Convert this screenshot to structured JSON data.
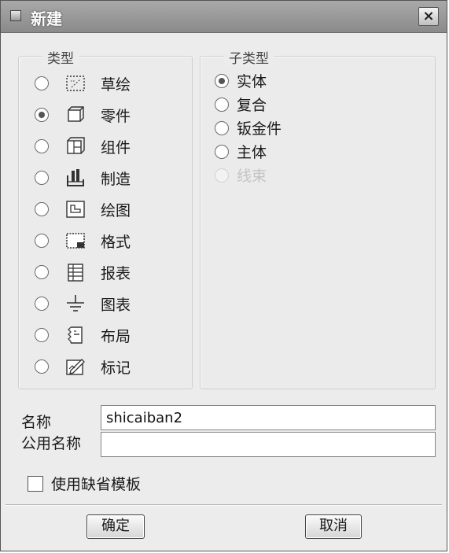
{
  "window": {
    "title": "新建",
    "close_label": "×"
  },
  "type_group": {
    "title": "类型",
    "items": [
      {
        "label": "草绘",
        "icon": "sketch-icon",
        "checked": false
      },
      {
        "label": "零件",
        "icon": "part-icon",
        "checked": true
      },
      {
        "label": "组件",
        "icon": "assembly-icon",
        "checked": false
      },
      {
        "label": "制造",
        "icon": "manufacturing-icon",
        "checked": false
      },
      {
        "label": "绘图",
        "icon": "drawing-icon",
        "checked": false
      },
      {
        "label": "格式",
        "icon": "format-icon",
        "checked": false
      },
      {
        "label": "报表",
        "icon": "report-icon",
        "checked": false
      },
      {
        "label": "图表",
        "icon": "diagram-icon",
        "checked": false
      },
      {
        "label": "布局",
        "icon": "layout-icon",
        "checked": false
      },
      {
        "label": "标记",
        "icon": "markup-icon",
        "checked": false
      }
    ]
  },
  "subtype_group": {
    "title": "子类型",
    "items": [
      {
        "label": "实体",
        "checked": true,
        "disabled": false
      },
      {
        "label": "复合",
        "checked": false,
        "disabled": false
      },
      {
        "label": "钣金件",
        "checked": false,
        "disabled": false
      },
      {
        "label": "主体",
        "checked": false,
        "disabled": false
      },
      {
        "label": "线束",
        "checked": false,
        "disabled": true
      }
    ]
  },
  "name_field": {
    "label": "名称",
    "value": "shicaiban2"
  },
  "common_name_field": {
    "label": "公用名称",
    "value": ""
  },
  "default_template": {
    "label": "使用缺省模板",
    "checked": false
  },
  "buttons": {
    "ok_label": "确定",
    "cancel_label": "取消"
  },
  "colors": {
    "titlebar": "#9a9a9a",
    "dialog_bg": "#ececec",
    "disabled_text": "#c4c4c4"
  }
}
